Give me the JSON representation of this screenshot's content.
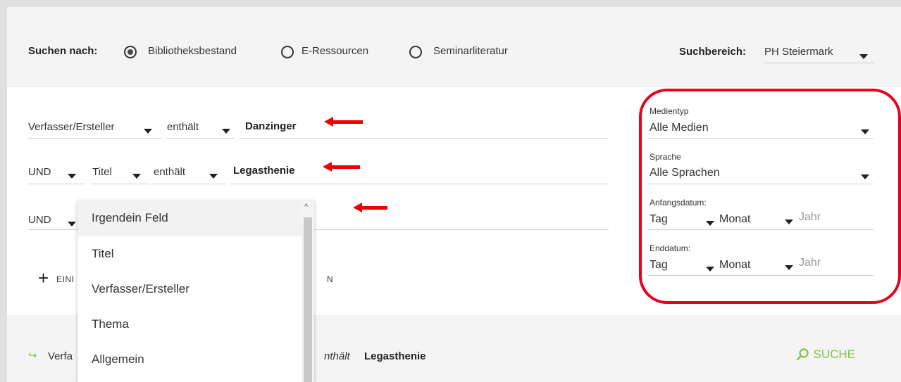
{
  "search_by": {
    "label": "Suchen nach:",
    "options": [
      "Bibliotheksbestand",
      "E-Ressourcen",
      "Seminarliteratur"
    ],
    "selected": "Bibliotheksbestand"
  },
  "scope": {
    "label": "Suchbereich:",
    "value": "PH Steiermark"
  },
  "rows": [
    {
      "field": "Verfasser/Ersteller",
      "op": "enthält",
      "value": "Danzinger"
    },
    {
      "bool": "UND",
      "field": "Titel",
      "op": "enthält",
      "value": "Legasthenie"
    },
    {
      "bool": "UND"
    }
  ],
  "add_row": {
    "prefix": "EINI",
    "suffix": "N"
  },
  "dropdown": {
    "items": [
      "Irgendein Feld",
      "Titel",
      "Verfasser/Ersteller",
      "Thema",
      "Allgemein"
    ],
    "highlighted": "Irgendein Feld"
  },
  "filters": {
    "media_type": {
      "label": "Medientyp",
      "value": "Alle Medien"
    },
    "language": {
      "label": "Sprache",
      "value": "Alle Sprachen"
    },
    "start_date": {
      "label": "Anfangsdatum:",
      "day": "Tag",
      "month": "Monat",
      "year": "Jahr"
    },
    "end_date": {
      "label": "Enddatum:",
      "day": "Tag",
      "month": "Monat",
      "year": "Jahr"
    }
  },
  "footer": {
    "summary_prefix": "Verfa",
    "summary_op": "nthält",
    "summary_value": "Legasthenie",
    "search_button": "SUCHE"
  },
  "colors": {
    "accent": "#8bc34a",
    "annotation_red": "#e8001c"
  }
}
